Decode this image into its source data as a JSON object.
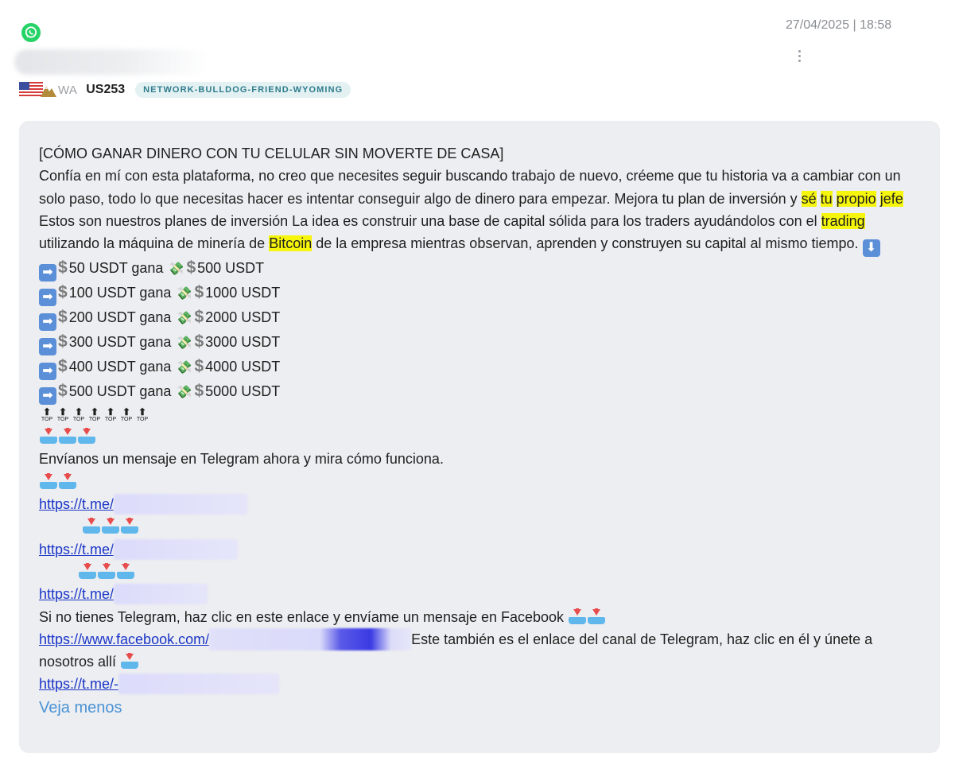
{
  "header": {
    "timestamp": "27/04/2025 | 18:58",
    "state_abbr": "WA",
    "code": "US253",
    "tag": "NETWORK-BULLDOG-FRIEND-WYOMING"
  },
  "message": {
    "title": "[CÓMO GANAR DINERO CON TU CELULAR SIN MOVERTE DE CASA]",
    "para_a": "Confía en mí con esta plataforma, no creo que necesites seguir buscando trabajo de nuevo, créeme que tu historia va a cambiar con un solo paso, todo lo que necesitas hacer es intentar conseguir algo de dinero para empezar. Mejora tu plan de inversión y ",
    "hl_1": "sé",
    "hl_2": "tu",
    "hl_3": "propio",
    "hl_4": "jefe",
    "para_b": " Estos son nuestros planes de inversión La idea es construir una base de capital sólida para los traders ayudándolos con el ",
    "hl_5": "trading",
    "para_c": " utilizando la máquina de minería de ",
    "hl_6": "Bitcoin",
    "para_d": " de la empresa mientras observan, aprenden y construyen su capital al mismo tiempo.",
    "plans": [
      {
        "from": "50 USDT gana",
        "to": "500 USDT"
      },
      {
        "from": "100 USDT gana",
        "to": "1000 USDT"
      },
      {
        "from": "200 USDT gana",
        "to": "2000 USDT"
      },
      {
        "from": "300 USDT gana",
        "to": "3000 USDT"
      },
      {
        "from": "400 USDT gana",
        "to": "4000 USDT"
      },
      {
        "from": "500 USDT gana",
        "to": "5000 USDT"
      }
    ],
    "top_label": "TOP",
    "telegram_line": "Envíanos un mensaje en Telegram ahora y mira cómo funciona.",
    "link_1": "https://t.me/",
    "link_2": "https://t.me/",
    "link_3": "https://t.me/",
    "facebook_line": "Si no tienes Telegram, haz clic en este enlace y envíame un mensaje en Facebook",
    "fb_link": "https://www.facebook.com/",
    "fb_after": "Este también es el enlace del canal de Telegram, haz clic en él y únete a nosotros allí",
    "link_4": "https://t.me/-",
    "see_less": "Veja menos"
  },
  "icons": {
    "app": "whatsapp-icon",
    "more": "more-vertical-icon",
    "flag": "us-flag-icon",
    "plan_arrow": "right-arrow-icon",
    "money": "money-with-wings-icon",
    "down": "down-arrow-icon",
    "inbox": "inbox-tray-icon"
  },
  "colors": {
    "highlight": "#f6f50c",
    "link": "#1a35c8",
    "see_less": "#4a93d6",
    "tag_bg": "#e3f1f3",
    "tag_text": "#2e7c8c",
    "card_bg": "#edeef1"
  }
}
